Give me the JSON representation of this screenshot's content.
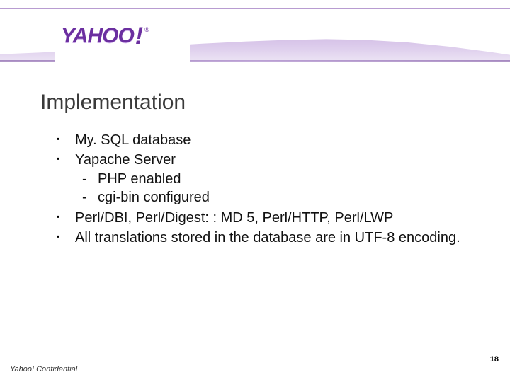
{
  "header": {
    "logo_text": "YAHOO",
    "logo_bang": "!",
    "logo_tm": "®"
  },
  "title": "Implementation",
  "bullets": [
    {
      "text": "My. SQL database"
    },
    {
      "text": "Yapache Server",
      "sub": [
        {
          "text": "PHP enabled"
        },
        {
          "text": "cgi-bin configured"
        }
      ]
    },
    {
      "text": "Perl/DBI, Perl/Digest: : MD 5, Perl/HTTP, Perl/LWP"
    },
    {
      "text": "All translations stored in the database are in UTF-8 encoding."
    }
  ],
  "footer": {
    "label": "Yahoo! Confidential",
    "page": "18"
  }
}
